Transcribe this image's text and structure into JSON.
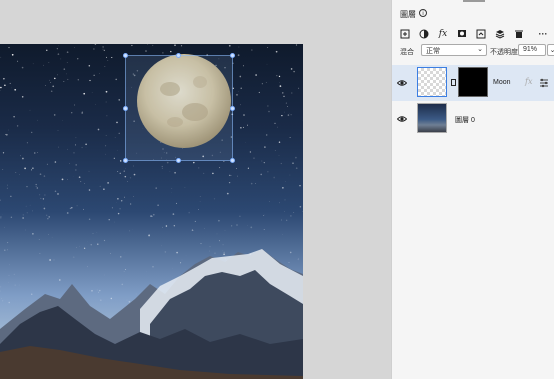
{
  "panel": {
    "title": "圖層",
    "info_icon": "i",
    "toolbar": [
      "add-layer-icon",
      "adjustment-icon",
      "fx-icon",
      "mask-icon",
      "clip-icon",
      "stack-icon",
      "trash-icon",
      "more-icon"
    ],
    "blend_label": "混合",
    "blend_value": "正常",
    "opacity_label": "不透明度",
    "opacity_value": "91%"
  },
  "layers": [
    {
      "name": "Moon",
      "fx": "fx",
      "selected": true
    },
    {
      "name": "圖層 0",
      "selected": false
    }
  ],
  "colors": {
    "accent": "#3b7ee3",
    "selected_row": "#dde7f4"
  }
}
